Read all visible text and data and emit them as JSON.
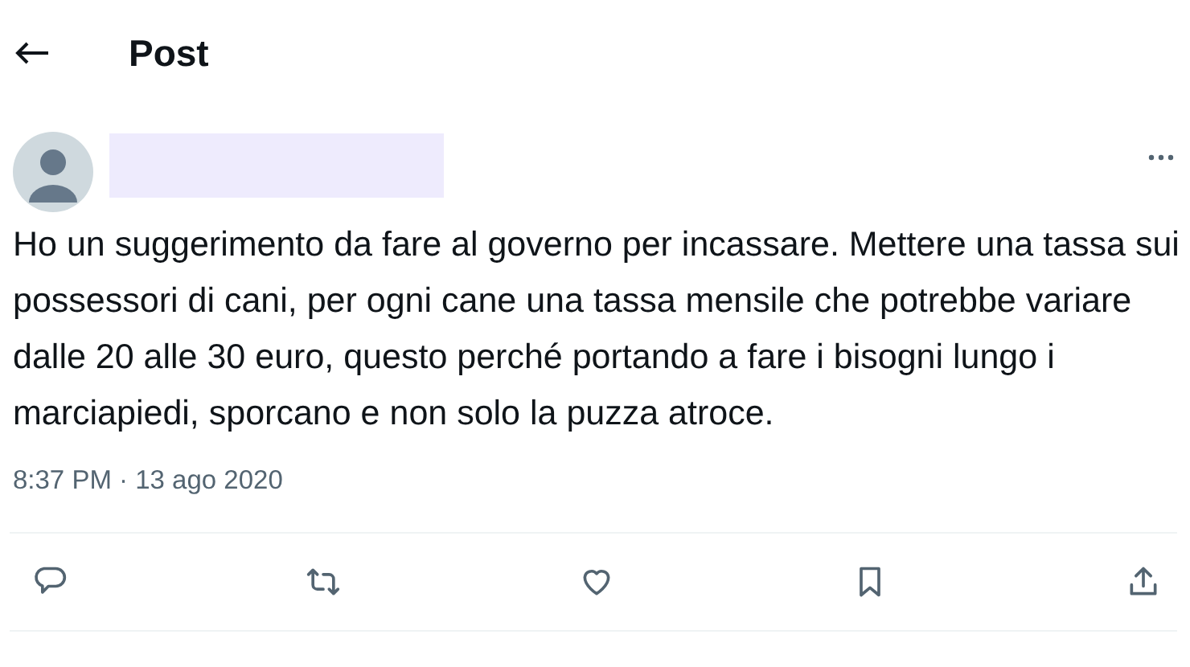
{
  "header": {
    "title": "Post"
  },
  "post": {
    "author": {
      "redacted": true
    },
    "text": "Ho un suggerimento da fare al governo per incassare. Mettere una tassa sui possessori di cani, per ogni cane una tassa mensile che potrebbe variare dalle 20 alle 30 euro, questo perché portando a fare i bisogni lungo i marciapiedi, sporcano e non solo la puzza atroce.",
    "timestamp": "8:37 PM · 13 ago 2020"
  },
  "actions": [
    {
      "kind": "reply"
    },
    {
      "kind": "repost"
    },
    {
      "kind": "like"
    },
    {
      "kind": "bookmark"
    },
    {
      "kind": "share"
    }
  ]
}
